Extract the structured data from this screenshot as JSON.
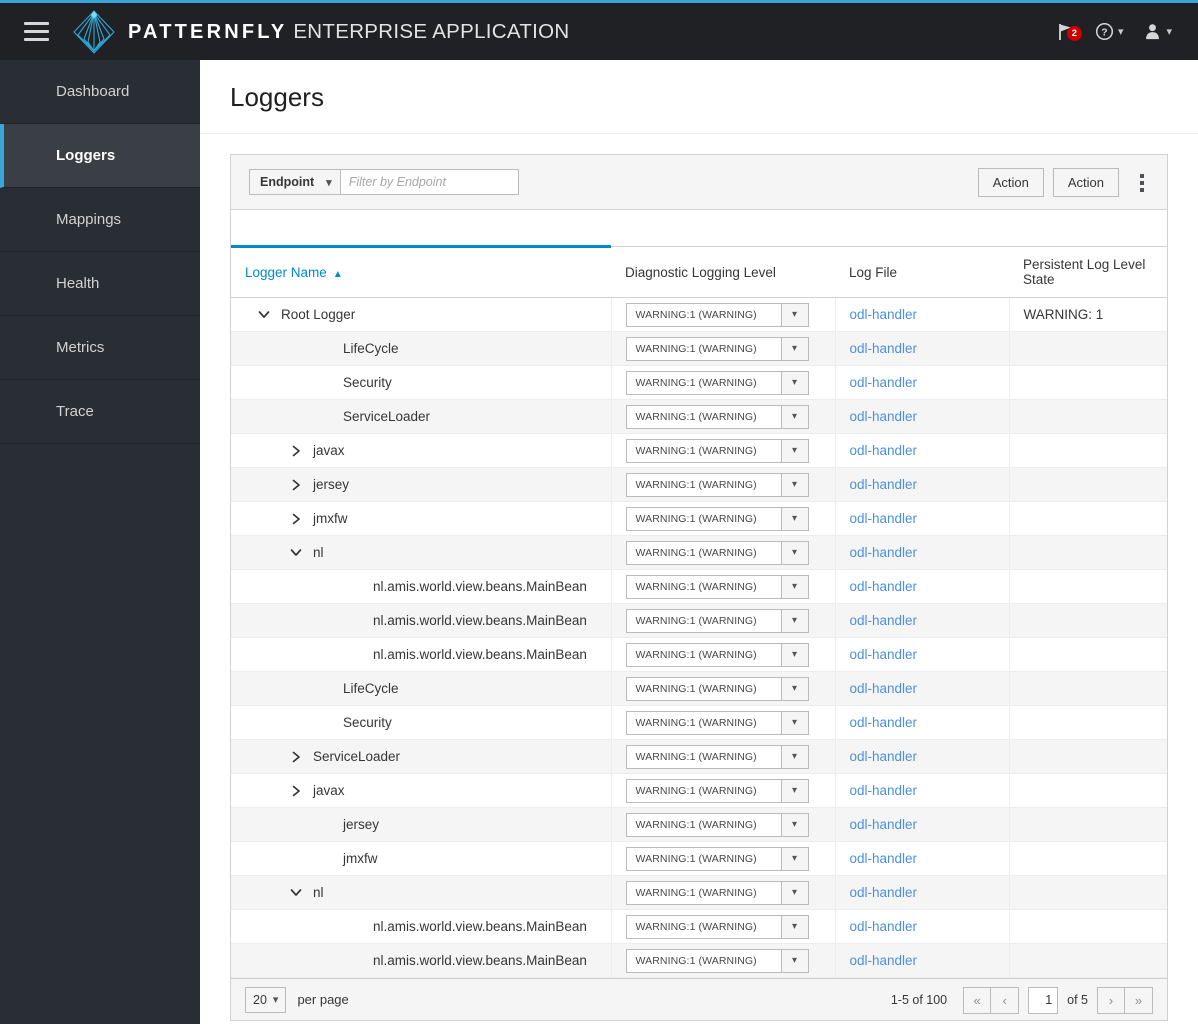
{
  "brand": {
    "bold_text": "PATTERNFLY",
    "light_text": "ENTERPRISE APPLICATION",
    "logo_icon": "patternfly-logo-icon",
    "accent_color": "#39a5dc"
  },
  "masthead": {
    "hamburger_icon": "hamburger-menu-icon",
    "flag_icon": "flag-icon",
    "flag_badge": "2",
    "help_icon": "help-circle-icon",
    "user_icon": "user-avatar-icon",
    "chevron_icon": "chevron-down-icon",
    "badge_color": "#cc0000"
  },
  "sidebar": {
    "items": [
      {
        "label": "Dashboard",
        "active": false
      },
      {
        "label": "Loggers",
        "active": true
      },
      {
        "label": "Mappings",
        "active": false
      },
      {
        "label": "Health",
        "active": false
      },
      {
        "label": "Metrics",
        "active": false
      },
      {
        "label": "Trace",
        "active": false
      }
    ]
  },
  "page": {
    "title": "Loggers"
  },
  "toolbar": {
    "filter_select_label": "Endpoint",
    "filter_select_caret": "chevron-down-icon",
    "filter_input_value": "",
    "filter_input_placeholder": "Filter by Endpoint",
    "action_one_label": "Action",
    "action_two_label": "Action",
    "kebab_icon": "kebab-vertical-icon"
  },
  "table": {
    "columns": [
      {
        "label": "Logger Name",
        "sorted": true,
        "sort_direction": "asc",
        "sort_caret": "caret-up-icon"
      },
      {
        "label": "Diagnostic Logging Level",
        "sorted": false
      },
      {
        "label": "Log File",
        "sorted": false
      },
      {
        "label": "Persistent Log Level State",
        "sorted": false
      }
    ],
    "sort_color": "#0088ce",
    "rows": [
      {
        "name": "Root Logger",
        "indent": 0,
        "toggle": "expanded",
        "level": "WARNING:1 (WARNING)",
        "log_file": "odl-handler",
        "state": "WARNING: 1"
      },
      {
        "name": "LifeCycle",
        "indent": 2,
        "toggle": "none",
        "level": "WARNING:1 (WARNING)",
        "log_file": "odl-handler",
        "state": ""
      },
      {
        "name": "Security",
        "indent": 2,
        "toggle": "none",
        "level": "WARNING:1 (WARNING)",
        "log_file": "odl-handler",
        "state": ""
      },
      {
        "name": "ServiceLoader",
        "indent": 2,
        "toggle": "none",
        "level": "WARNING:1 (WARNING)",
        "log_file": "odl-handler",
        "state": ""
      },
      {
        "name": "javax",
        "indent": 1,
        "toggle": "collapsed",
        "level": "WARNING:1 (WARNING)",
        "log_file": "odl-handler",
        "state": ""
      },
      {
        "name": "jersey",
        "indent": 1,
        "toggle": "collapsed",
        "level": "WARNING:1 (WARNING)",
        "log_file": "odl-handler",
        "state": ""
      },
      {
        "name": "jmxfw",
        "indent": 1,
        "toggle": "collapsed",
        "level": "WARNING:1 (WARNING)",
        "log_file": "odl-handler",
        "state": ""
      },
      {
        "name": "nl",
        "indent": 1,
        "toggle": "expanded",
        "level": "WARNING:1 (WARNING)",
        "log_file": "odl-handler",
        "state": ""
      },
      {
        "name": "nl.amis.world.view.beans.MainBean",
        "indent": 3,
        "toggle": "none",
        "level": "WARNING:1 (WARNING)",
        "log_file": "odl-handler",
        "state": ""
      },
      {
        "name": "nl.amis.world.view.beans.MainBean",
        "indent": 3,
        "toggle": "none",
        "level": "WARNING:1 (WARNING)",
        "log_file": "odl-handler",
        "state": ""
      },
      {
        "name": "nl.amis.world.view.beans.MainBean",
        "indent": 3,
        "toggle": "none",
        "level": "WARNING:1 (WARNING)",
        "log_file": "odl-handler",
        "state": ""
      },
      {
        "name": "LifeCycle",
        "indent": 2,
        "toggle": "none",
        "level": "WARNING:1 (WARNING)",
        "log_file": "odl-handler",
        "state": ""
      },
      {
        "name": "Security",
        "indent": 2,
        "toggle": "none",
        "level": "WARNING:1 (WARNING)",
        "log_file": "odl-handler",
        "state": ""
      },
      {
        "name": "ServiceLoader",
        "indent": 1,
        "toggle": "collapsed",
        "level": "WARNING:1 (WARNING)",
        "log_file": "odl-handler",
        "state": ""
      },
      {
        "name": "javax",
        "indent": 1,
        "toggle": "collapsed",
        "level": "WARNING:1 (WARNING)",
        "log_file": "odl-handler",
        "state": ""
      },
      {
        "name": "jersey",
        "indent": 2,
        "toggle": "none",
        "level": "WARNING:1 (WARNING)",
        "log_file": "odl-handler",
        "state": ""
      },
      {
        "name": "jmxfw",
        "indent": 2,
        "toggle": "none",
        "level": "WARNING:1 (WARNING)",
        "log_file": "odl-handler",
        "state": ""
      },
      {
        "name": "nl",
        "indent": 1,
        "toggle": "expanded",
        "level": "WARNING:1 (WARNING)",
        "log_file": "odl-handler",
        "state": ""
      },
      {
        "name": "nl.amis.world.view.beans.MainBean",
        "indent": 3,
        "toggle": "none",
        "level": "WARNING:1 (WARNING)",
        "log_file": "odl-handler",
        "state": ""
      },
      {
        "name": "nl.amis.world.view.beans.MainBean",
        "indent": 3,
        "toggle": "none",
        "level": "WARNING:1 (WARNING)",
        "log_file": "odl-handler",
        "state": ""
      }
    ]
  },
  "pagination": {
    "per_page_value": "20",
    "per_page_label": "per page",
    "range_text": "1-5 of 100",
    "first_icon": "«",
    "prev_icon": "‹",
    "next_icon": "›",
    "last_icon": "»",
    "current_page": "1",
    "of_text": "of 5"
  }
}
